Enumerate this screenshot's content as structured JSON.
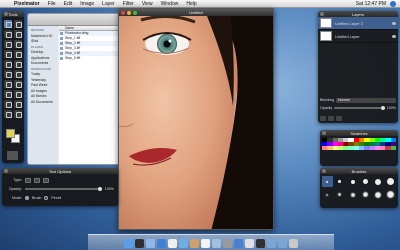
{
  "menubar": {
    "app_name": "Pixelmator",
    "items": [
      "File",
      "Edit",
      "Image",
      "Layer",
      "Filter",
      "View",
      "Window",
      "Help"
    ],
    "clock": "Sat 12:47 PM"
  },
  "tools_panel": {
    "title": "Tools"
  },
  "finder": {
    "sidebar": [
      {
        "label": "DEVICES",
        "header": true
      },
      {
        "label": "Macintosh HD"
      },
      {
        "label": "iDisk"
      },
      {
        "label": "PLACES",
        "header": true
      },
      {
        "label": "Desktop"
      },
      {
        "label": "Applications"
      },
      {
        "label": "Documents"
      },
      {
        "label": "SEARCH FOR",
        "header": true
      },
      {
        "label": "Today"
      },
      {
        "label": "Yesterday"
      },
      {
        "label": "Past Week"
      },
      {
        "label": "All Images"
      },
      {
        "label": "All Movies"
      },
      {
        "label": "All Documents"
      }
    ],
    "column_header": "Name",
    "files": [
      "Pixelmator.dmg",
      "Step_1.tiff",
      "Step_2.tiff",
      "Step_3.tiff",
      "Step_4.tiff",
      "Step_5.tiff"
    ]
  },
  "image_window": {
    "title": "Untitled"
  },
  "layers_panel": {
    "title": "Layers",
    "layers": [
      "Untitled Layer 2",
      "Untitled Layer"
    ],
    "blending_label": "Blending",
    "blending_value": "Normal",
    "opacity_label": "Opacity",
    "opacity_value": "100%",
    "opacity_fraction": 1.0
  },
  "swatches_panel": {
    "title": "Swatches",
    "colors": [
      "#000000",
      "#333333",
      "#666666",
      "#999999",
      "#cccccc",
      "#ffffff",
      "#ff0000",
      "#ff8000",
      "#ffff00",
      "#80ff00",
      "#00ff00",
      "#00ff80",
      "#00ffff",
      "#0080ff",
      "#0000ff",
      "#8000ff",
      "#ff00ff",
      "#ff0080",
      "#800000",
      "#804000",
      "#808000",
      "#408000",
      "#008000",
      "#008040",
      "#008080",
      "#004080",
      "#000080",
      "#400080",
      "#ff8080",
      "#ffc080",
      "#ffff80",
      "#c0ff80",
      "#80ff80",
      "#80ffc0",
      "#80ffff",
      "#80c0ff",
      "#8080ff",
      "#c080ff",
      "#ff80ff",
      "#ff80c0",
      "#c04040",
      "#40c040"
    ]
  },
  "brushes_panel": {
    "title": "Brushes",
    "brushes": [
      {
        "selected": true
      },
      {
        "selected": false
      },
      {
        "selected": false
      },
      {
        "selected": false
      },
      {
        "selected": false
      },
      {
        "selected": false
      },
      {
        "selected": false
      },
      {
        "selected": false
      },
      {
        "selected": false
      },
      {
        "selected": false
      },
      {
        "selected": false
      },
      {
        "selected": false
      }
    ]
  },
  "tool_options": {
    "title": "Tool Options",
    "type_label": "Type:",
    "opacity_label": "Opacity:",
    "opacity_value": "100%",
    "opacity_fraction": 1.0,
    "mode_label": "Mode:",
    "mode_options": [
      "Brush",
      "Pencil"
    ],
    "mode_selected": "Brush"
  },
  "dock": {
    "apps": [
      "finder-icon",
      "dashboard-icon",
      "mail-icon",
      "safari-icon",
      "ichat-icon",
      "itunes-icon",
      "iphoto-icon",
      "ical-icon",
      "preview-icon",
      "system-preferences-icon",
      "pixelmator-icon",
      "textedit-icon",
      "terminal-icon",
      "applications-folder-icon",
      "documents-folder-icon",
      "trash-icon"
    ],
    "colors": [
      "#5aa0e8",
      "#2f2f2f",
      "#8fb8e8",
      "#3c82d6",
      "#f0f0f0",
      "#6ab0e8",
      "#d0a070",
      "#f4f4f4",
      "#a0c0e0",
      "#9a9a9a",
      "#4a7fd0",
      "#e0e0e0",
      "#303030",
      "#7aa6d6",
      "#7aa6d6",
      "#c8c8c8"
    ]
  }
}
